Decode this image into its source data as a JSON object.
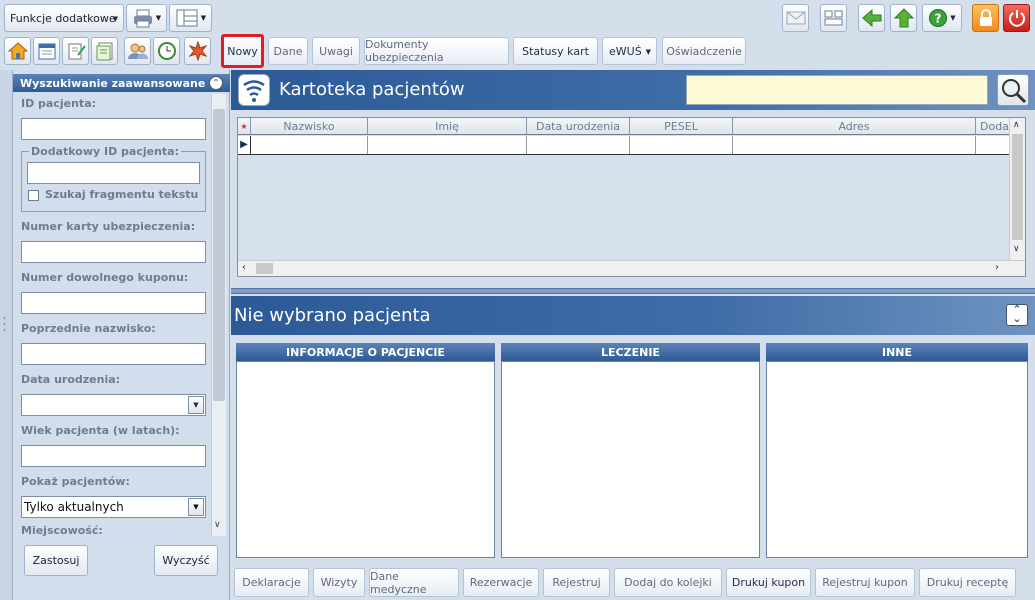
{
  "toolbar": {
    "functions_label": "Funkcje dodatkowe",
    "tabs": [
      "Nowy",
      "Dane",
      "Uwagi",
      "Dokumenty ubezpieczenia",
      "Statusy kart",
      "eWUŚ",
      "Oświadczenie"
    ]
  },
  "search": {
    "title": "Wyszukiwanie zaawansowane",
    "id_label": "ID pacjenta:",
    "extra_id_label": "Dodatkowy ID pacjenta:",
    "fragment_label": "Szukaj fragmentu tekstu",
    "card_label": "Numer karty ubezpieczenia:",
    "coupon_label": "Numer dowolnego kuponu:",
    "prev_name_label": "Poprzednie nazwisko:",
    "birth_label": "Data urodzenia:",
    "age_label": "Wiek pacjenta (w latach):",
    "show_label": "Pokaż pacjentów:",
    "show_value": "Tylko aktualnych",
    "city_label": "Miejscowość:",
    "apply_label": "Zastosuj",
    "clear_label": "Wyczyść"
  },
  "card_index": {
    "title": "Kartoteka pacjentów",
    "columns": [
      "Nazwisko",
      "Imię",
      "Data urodzenia",
      "PESEL",
      "Adres",
      "Doda"
    ]
  },
  "patient": {
    "title": "Nie wybrano pacjenta",
    "sections": [
      "INFORMACJE O PACJENCIE",
      "LECZENIE",
      "INNE"
    ]
  },
  "bottom": {
    "buttons": [
      "Deklaracje",
      "Wizyty",
      "Dane medyczne",
      "Rezerwacje",
      "Rejestruj",
      "Dodaj do kolejki",
      "Drukuj kupon",
      "Rejestruj kupon",
      "Drukuj receptę"
    ]
  },
  "colors": {
    "accent": "#2e5a96",
    "highlight": "#e21b24",
    "search_bg": "#fdfad8"
  }
}
